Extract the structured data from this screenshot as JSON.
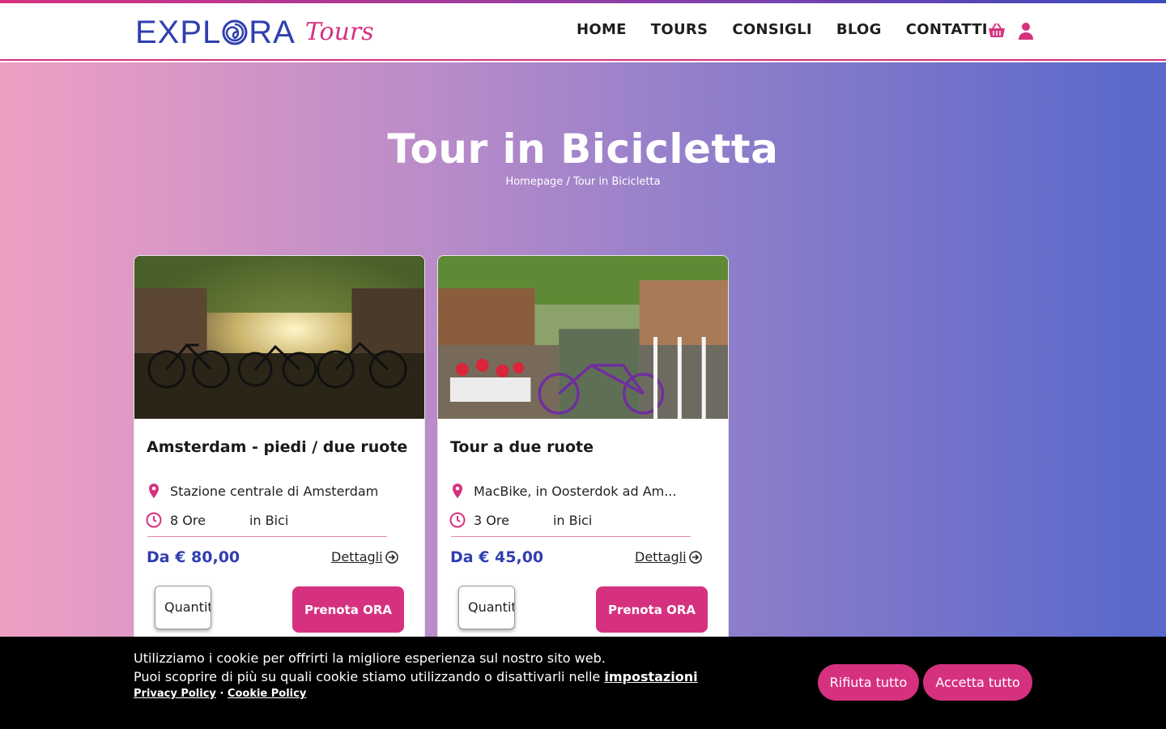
{
  "brand": {
    "name_main_left": "EXPL",
    "name_main_right": "RA",
    "name_script": "Tours",
    "primary_color": "#2f3fae",
    "accent_color": "#d6317f"
  },
  "nav": {
    "items": [
      "HOME",
      "TOURS",
      "CONSIGLI",
      "BLOG",
      "CONTATTI"
    ],
    "icons": [
      "basket-icon",
      "user-icon"
    ]
  },
  "hero": {
    "title": "Tour in Bicicletta",
    "breadcrumb_home": "Homepage",
    "breadcrumb_sep": "/",
    "breadcrumb_current": "Tour in Bicicletta"
  },
  "tours": [
    {
      "title": "Amsterdam - piedi / due ruote",
      "location": "Stazione centrale di Amsterdam",
      "duration": "8 Ore",
      "mode": "in Bici",
      "price": "Da € 80,00",
      "details_label": "Dettagli",
      "qty_placeholder": "Quantità",
      "book_label": "Prenota ORA"
    },
    {
      "title": "Tour a due ruote",
      "location": "MacBike, in Oosterdok ad Am...",
      "duration": "3 Ore",
      "mode": "in Bici",
      "price": "Da € 45,00",
      "details_label": "Dettagli",
      "qty_placeholder": "Quantità",
      "book_label": "Prenota ORA"
    }
  ],
  "cookie": {
    "line1": "Utilizziamo i cookie per offrirti la migliore esperienza sul nostro sito web.",
    "line2": "Puoi scoprire di più su quali cookie stiamo utilizzando o disattivarli nelle",
    "settings_link": "impostazioni",
    "privacy_link": "Privacy Policy",
    "separator": "·",
    "cookie_link": "Cookie Policy",
    "reject_label": "Rifiuta tutto",
    "accept_label": "Accetta tutto"
  }
}
